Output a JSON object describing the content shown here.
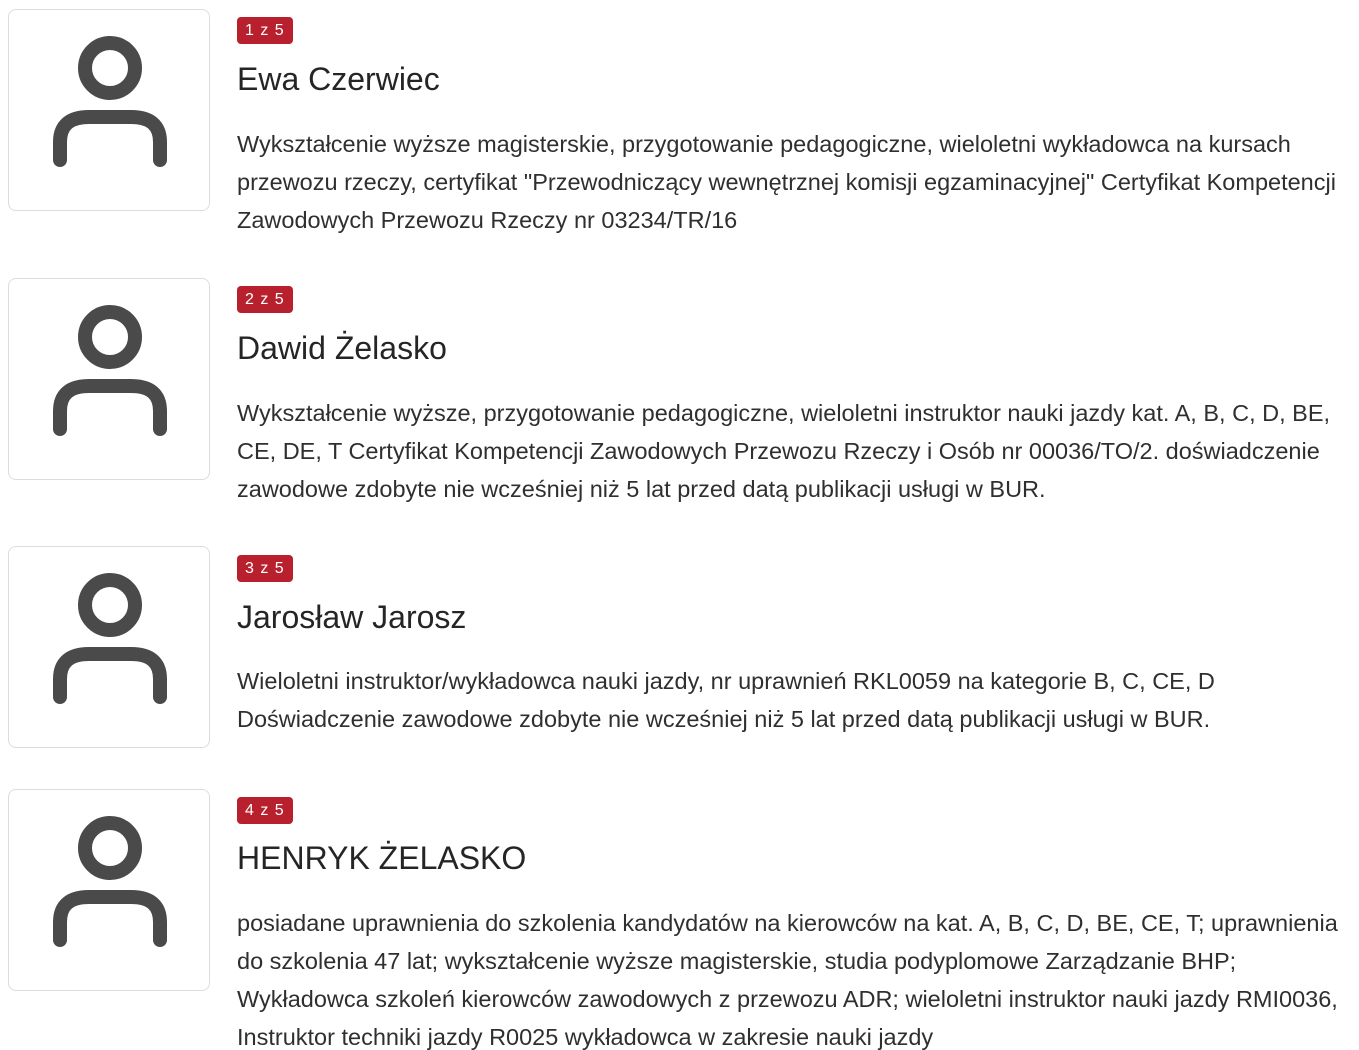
{
  "trainers": [
    {
      "counter": "1 z 5",
      "name": "Ewa Czerwiec",
      "description": "Wykształcenie wyższe magisterskie, przygotowanie pedagogiczne, wieloletni wykładowca na kursach przewozu rzeczy, certyfikat \"Przewodniczący wewnętrznej komisji egzaminacyjnej\" Certyfikat Kompetencji Zawodowych Przewozu Rzeczy nr 03234/TR/16",
      "avatar_icon": "user-icon"
    },
    {
      "counter": "2 z 5",
      "name": "Dawid Żelasko",
      "description": "Wykształcenie wyższe, przygotowanie pedagogiczne, wieloletni instruktor nauki jazdy kat. A, B, C, D, BE, CE, DE, T Certyfikat Kompetencji Zawodowych Przewozu Rzeczy i Osób nr 00036/TO/2. doświadczenie zawodowe zdobyte nie wcześniej niż 5 lat przed datą publikacji usługi w BUR.",
      "avatar_icon": "user-icon"
    },
    {
      "counter": "3 z 5",
      "name": "Jarosław Jarosz",
      "description": "Wieloletni instruktor/wykładowca nauki jazdy, nr uprawnień RKL0059 na kategorie B, C, CE, D Doświadczenie zawodowe zdobyte nie wcześniej niż 5 lat przed datą publikacji usługi w BUR.",
      "avatar_icon": "user-icon"
    },
    {
      "counter": "4 z 5",
      "name": "HENRYK ŻELASKO",
      "description": "posiadane uprawnienia do szkolenia kandydatów na kierowców na kat. A, B, C, D, BE, CE, T; uprawnienia do szkolenia 47 lat; wykształcenie wyższe magisterskie, studia podyplomowe Zarządzanie BHP; Wykładowca szkoleń kierowców zawodowych z przewozu ADR; wieloletni instruktor nauki jazdy RMI0036, Instruktor techniki jazdy R0025 wykładowca w zakresie nauki jazdy",
      "avatar_icon": "user-icon"
    }
  ],
  "colors": {
    "badge_bg": "#b8202d",
    "badge_text": "#ffffff",
    "icon": "#4a4a4a",
    "border": "#dcdcdc"
  }
}
